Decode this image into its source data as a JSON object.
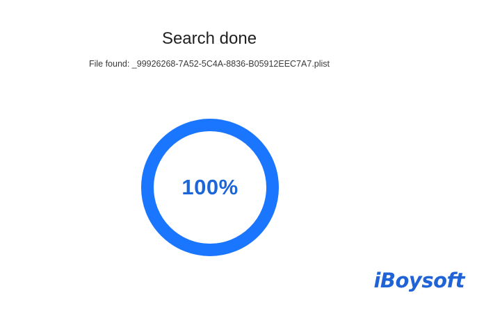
{
  "status": {
    "title": "Search done",
    "file_found": "File found: _99926268-7A52-5C4A-8836-B05912EEC7A7.plist"
  },
  "progress": {
    "value": 1.0,
    "label": "100%",
    "color": "#1a75ff"
  },
  "brand": {
    "name": "iBoysoft",
    "color": "#1f63d6"
  }
}
